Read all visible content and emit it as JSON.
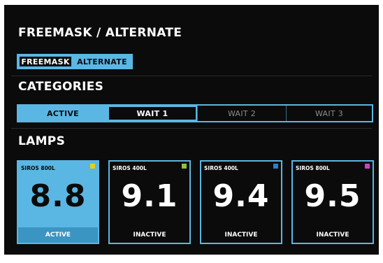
{
  "freemask_section": {
    "title": "FREEMASK / ALTERNATE",
    "options": [
      "FREEMASK",
      "ALTERNATE"
    ],
    "selected": "ALTERNATE"
  },
  "categories_section": {
    "title": "CATEGORIES",
    "tabs": [
      "ACTIVE",
      "WAIT 1",
      "WAIT 2",
      "WAIT 3"
    ]
  },
  "lamps_section": {
    "title": "LAMPS",
    "lamps": [
      {
        "name": "SIROS 800L",
        "value": "8.8",
        "status": "ACTIVE",
        "swatch": "#e2d21c"
      },
      {
        "name": "SIROS 400L",
        "value": "9.1",
        "status": "INACTIVE",
        "swatch": "#8ac43b"
      },
      {
        "name": "SIROS 400L",
        "value": "9.4",
        "status": "INACTIVE",
        "swatch": "#2c7fd0"
      },
      {
        "name": "SIROS 800L",
        "value": "9.5",
        "status": "INACTIVE",
        "swatch": "#d43ccf"
      }
    ]
  },
  "colors": {
    "accent": "#5ab7e3",
    "background": "#0b0b0b",
    "text": "#ffffff",
    "muted": "#8c8c8c"
  }
}
